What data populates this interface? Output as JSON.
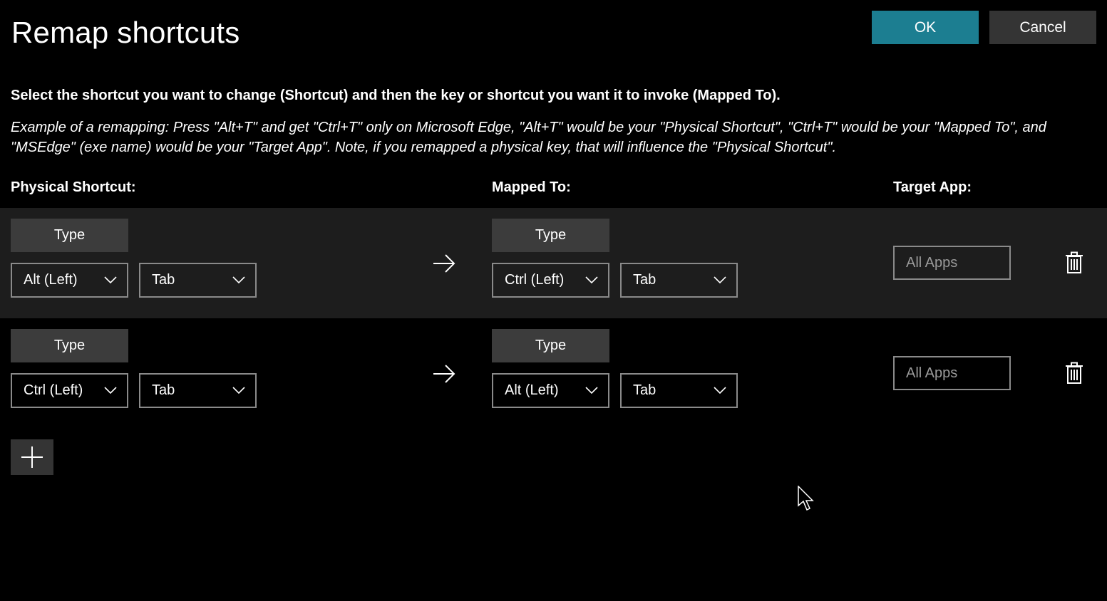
{
  "window": {
    "title": "Remap shortcuts"
  },
  "actions": {
    "ok_label": "OK",
    "cancel_label": "Cancel"
  },
  "instructions": {
    "main": "Select the shortcut you want to change (Shortcut) and then the key or shortcut you want it to invoke (Mapped To).",
    "example": "Example of a remapping: Press \"Alt+T\" and get \"Ctrl+T\" only on Microsoft Edge, \"Alt+T\" would be your \"Physical Shortcut\", \"Ctrl+T\" would be your \"Mapped To\", and \"MSEdge\" (exe name) would be your \"Target App\". Note, if you remapped a physical key, that will influence the \"Physical Shortcut\"."
  },
  "columns": {
    "physical": "Physical Shortcut:",
    "mapped": "Mapped To:",
    "target": "Target App:"
  },
  "rows": [
    {
      "physical_type_label": "Type",
      "physical_keys": [
        "Alt (Left)",
        "Tab"
      ],
      "mapped_type_label": "Type",
      "mapped_keys": [
        "Ctrl (Left)",
        "Tab"
      ],
      "target_app_placeholder": "All Apps"
    },
    {
      "physical_type_label": "Type",
      "physical_keys": [
        "Ctrl (Left)",
        "Tab"
      ],
      "mapped_type_label": "Type",
      "mapped_keys": [
        "Alt (Left)",
        "Tab"
      ],
      "target_app_placeholder": "All Apps"
    }
  ],
  "colors": {
    "background": "#000000",
    "row_highlight": "#1d1d1d",
    "accent": "#1c7e91",
    "button": "#343434",
    "type_button": "#3c3c3c",
    "border": "#8a8a8a"
  },
  "icons": {
    "arrow": "arrow-right-icon",
    "delete": "trash-icon",
    "add": "plus-icon",
    "dropdown": "chevron-down-icon"
  }
}
